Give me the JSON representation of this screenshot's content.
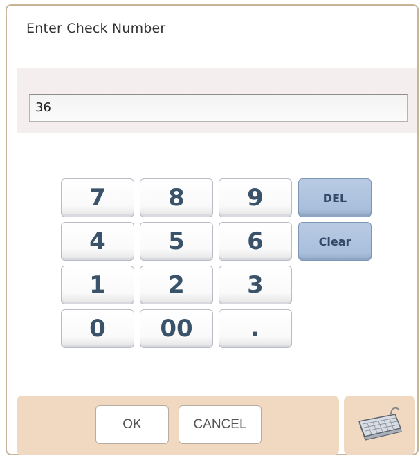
{
  "dialog": {
    "title": "Enter Check Number"
  },
  "input": {
    "value": "36"
  },
  "keypad": {
    "digits": [
      "7",
      "8",
      "9",
      "4",
      "5",
      "6",
      "1",
      "2",
      "3",
      "0",
      "00",
      "."
    ],
    "del_label": "DEL",
    "clear_label": "Clear"
  },
  "footer": {
    "ok_label": "OK",
    "cancel_label": "CANCEL",
    "keyboard_icon": "keyboard-icon"
  },
  "colors": {
    "frame": "#c9b49a",
    "footer_band": "#f0d9c0",
    "function_key": "#a9bfdc",
    "digit_text": "#3a536a"
  }
}
